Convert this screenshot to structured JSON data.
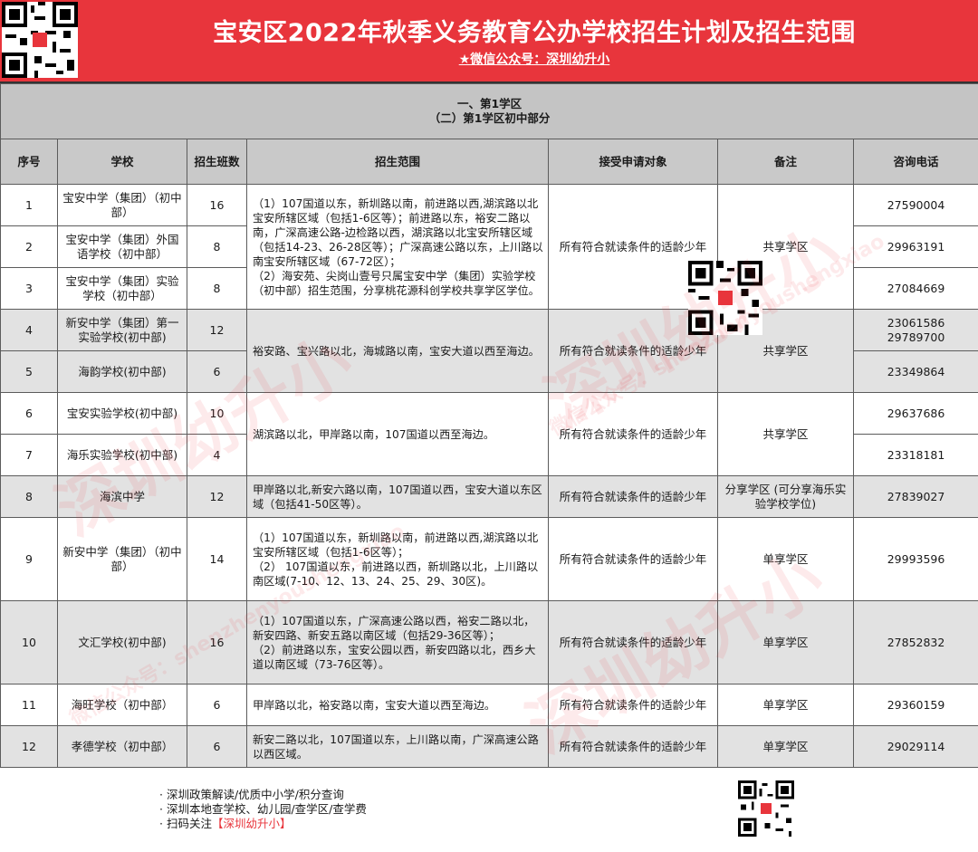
{
  "header": {
    "title": "宝安区2022年秋季义务教育公办学校招生计划及招生范围",
    "subtitle": "★微信公众号：深圳幼升小"
  },
  "section": {
    "line1": "一、第1学区",
    "line2": "（二）第1学区初中部分"
  },
  "columns": [
    "序号",
    "学校",
    "招生班数",
    "招生范围",
    "接受申请对象",
    "备注",
    "咨询电话"
  ],
  "rows": [
    {
      "no": "1",
      "school": "宝安中学（集团）（初中部）",
      "classes": "16",
      "phone": "27590004"
    },
    {
      "no": "2",
      "school": "宝安中学（集团）外国语学校（初中部）",
      "classes": "8",
      "phone": "29963191"
    },
    {
      "no": "3",
      "school": "宝安中学（集团）实验学校（初中部）",
      "classes": "8",
      "phone": "27084669"
    },
    {
      "no": "4",
      "school": "新安中学（集团）第一实验学校(初中部)",
      "classes": "12",
      "phone": "23061586\n29789700"
    },
    {
      "no": "5",
      "school": "海韵学校(初中部)",
      "classes": "6",
      "phone": "23349864"
    },
    {
      "no": "6",
      "school": "宝安实验学校(初中部)",
      "classes": "10",
      "phone": "29637686"
    },
    {
      "no": "7",
      "school": "海乐实验学校(初中部)",
      "classes": "4",
      "phone": "23318181"
    },
    {
      "no": "8",
      "school": "海滨中学",
      "classes": "12",
      "phone": "27839027"
    },
    {
      "no": "9",
      "school": "新安中学（集团）（初中部）",
      "classes": "14",
      "phone": "29993596"
    },
    {
      "no": "10",
      "school": "文汇学校(初中部)",
      "classes": "16",
      "phone": "27852832"
    },
    {
      "no": "11",
      "school": "海旺学校（初中部）",
      "classes": "6",
      "phone": "29360159"
    },
    {
      "no": "12",
      "school": "孝德学校（初中部）",
      "classes": "6",
      "phone": "29029114"
    }
  ],
  "groups": {
    "g1": {
      "range": "（1）107国道以东，新圳路以南，前进路以西,湖滨路以北宝安所辖区域（包括1-6区等）；前进路以东，裕安二路以南，广深高速公路-边检路以西，湖滨路以北宝安所辖区域（包括14-23、26-28区等）；广深高速公路以东，上川路以南宝安所辖区域（67-72区）；\n（2）海安苑、尖岗山壹号只属宝安中学（集团）实验学校（初中部）招生范围，分享桃花源科创学校共享学区学位。",
      "target": "所有符合就读条件的适龄少年",
      "note": "共享学区"
    },
    "g2": {
      "range": "裕安路、宝兴路以北，海城路以南，宝安大道以西至海边。",
      "target": "所有符合就读条件的适龄少年",
      "note": "共享学区"
    },
    "g3": {
      "range": "湖滨路以北，甲岸路以南，107国道以西至海边。",
      "target": "所有符合就读条件的适龄少年",
      "note": "共享学区"
    },
    "g8": {
      "range": "甲岸路以北,新安六路以南，107国道以西，宝安大道以东区域（包括41-50区等）。",
      "target": "所有符合就读条件的适龄少年",
      "note": "分享学区 (可分享海乐实验学校学位)"
    },
    "g9": {
      "range": "（1）107国道以东，新圳路以南，前进路以西,湖滨路以北宝安所辖区域（包括1-6区等）；\n（2） 107国道以东，前进路以西，新圳路以北，上川路以南区域(7-10、12、13、24、25、29、30区)。",
      "target": "所有符合就读条件的适龄少年",
      "note": "单享学区"
    },
    "g10": {
      "range": "（1）107国道以东，广深高速公路以西，裕安二路以北，新安四路、新安五路以南区域（包括29-36区等）；\n（2）前进路以东，宝安公园以西，新安四路以北，西乡大道以南区域（73-76区等）。",
      "target": "所有符合就读条件的适龄少年",
      "note": "单享学区"
    },
    "g11": {
      "range": "甲岸路以北，裕安路以南，宝安大道以西至海边。",
      "target": "所有符合就读条件的适龄少年",
      "note": "单享学区"
    },
    "g12": {
      "range": "新安二路以北，107国道以东，上川路以南，广深高速公路以西区域。",
      "target": "所有符合就读条件的适龄少年",
      "note": "单享学区"
    }
  },
  "footer": {
    "items": [
      "深圳政策解读/优质中小学/积分查询",
      "深圳本地查学校、幼儿园/查学区/查学费"
    ],
    "scan_prefix": "扫码关注",
    "scan_name": "【深圳幼升小】"
  },
  "watermark": {
    "big": "深圳幼升小",
    "small": "微信公众号：shenzhenyoushengxiao"
  },
  "colors": {
    "brand_red": "#e8353c",
    "section_gray": "#c4c4c4",
    "row_shade": "#e2e2e2"
  }
}
